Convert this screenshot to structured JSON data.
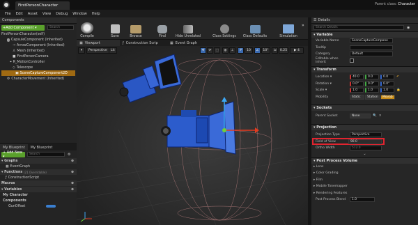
{
  "window": {
    "tab_title": "FirstPersonCharacter",
    "parent_class_label": "Parent class:",
    "parent_class_value": "Character"
  },
  "menu": [
    "File",
    "Edit",
    "Asset",
    "View",
    "Debug",
    "Window",
    "Help"
  ],
  "components": {
    "header": "Components",
    "add_button": "+Add Component ▾",
    "search_placeholder": "Search",
    "items": [
      "FirstPersonCharacter(self)",
      "CapsuleComponent (Inherited)",
      "ArrowComponent (Inherited)",
      "Mesh (Inherited)",
      "FirstPersonCamera",
      "R_MotionController",
      "Telescope",
      "SceneCaptureComponent2D",
      "CharacterMovement (Inherited)"
    ]
  },
  "toolbar": [
    {
      "label": "Compile"
    },
    {
      "label": "Save"
    },
    {
      "label": "Browse"
    },
    {
      "label": "Find"
    },
    {
      "label": "Hide Unrelated"
    },
    {
      "label": "Class Settings"
    },
    {
      "label": "Class Defaults"
    },
    {
      "label": "Simulation"
    }
  ],
  "viewport_tabs": [
    "Viewport",
    "Construction Scrip",
    "Event Graph"
  ],
  "viewport": {
    "perspective": "Perspective",
    "lit": "Lit",
    "grid_size": "10",
    "rot_size": "10°",
    "scale_size": "0.25",
    "cam_speed": "4"
  },
  "myblueprint": {
    "tab1": "My Blueprint",
    "tab2": "My Blueprint",
    "add_new": "+ Add New ▾",
    "search_placeholder": "Search",
    "graphs": "Graphs",
    "event_graph": "EventGraph",
    "functions": "Functions",
    "functions_note": "(21 Overridable)",
    "construction": "ConstructionScript",
    "macros": "Macros",
    "variables": "Variables",
    "my_character": "My Character",
    "components": "Components",
    "gun_offset": "GunOffset"
  },
  "details": {
    "tab": "Details",
    "search_placeholder": "Search Details",
    "variable_section": "Variable",
    "variable_rows": [
      {
        "label": "Variable Name",
        "value": "SceneCaptureCompone"
      },
      {
        "label": "Tooltip",
        "value": ""
      },
      {
        "label": "Category",
        "value": "Default"
      },
      {
        "label": "Editable when Inherit",
        "value": ""
      }
    ],
    "transform_section": "Transform",
    "location_label": "Location ▾",
    "location": [
      "40.0",
      "0.0",
      "0.0"
    ],
    "rotation_label": "Rotation ▾",
    "rotation": [
      "0.0°",
      "0.0°",
      "0.0°"
    ],
    "scale_label": "Scale ▾",
    "scale": [
      "1.0",
      "1.0",
      "1.0"
    ],
    "mobility_label": "Mobility",
    "mobility": [
      "Static",
      "Station",
      "Movab"
    ],
    "sockets_section": "Sockets",
    "parent_socket_label": "Parent Socket",
    "parent_socket_value": "None",
    "projection_section": "Projection",
    "projection_type_label": "Projection Type",
    "projection_type_value": "Perspective",
    "fov_label": "Field of View",
    "fov_value": "90.0",
    "ortho_label": "Ortho Width",
    "ortho_value": "512.0",
    "ppv_section": "Post Process Volume",
    "ppv_items": [
      "Lens",
      "Color Grading",
      "Film",
      "Mobile Tonemapper",
      "Rendering Features"
    ],
    "ppb_label": "Post Process Blend",
    "ppb_value": "1.0"
  },
  "colors": {
    "accent": "#3da8f5",
    "add_green": "#5aa02c",
    "highlight_red": "#e2242f",
    "selected_orange": "#a06a12"
  }
}
